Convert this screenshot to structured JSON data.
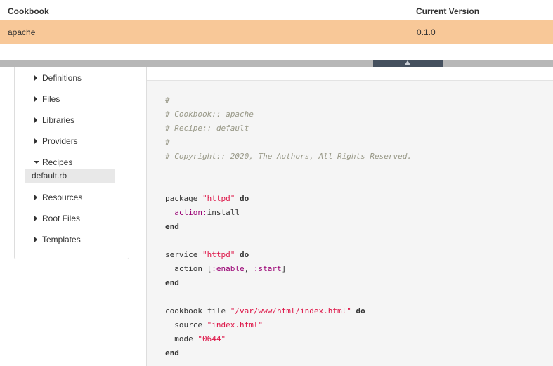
{
  "table": {
    "headers": {
      "cookbook": "Cookbook",
      "version": "Current Version"
    },
    "row": {
      "cookbook": "apache",
      "version": "0.1.0"
    }
  },
  "tree": {
    "items": [
      {
        "label": "Definitions",
        "expanded": false
      },
      {
        "label": "Files",
        "expanded": false
      },
      {
        "label": "Libraries",
        "expanded": false
      },
      {
        "label": "Providers",
        "expanded": false
      },
      {
        "label": "Recipes",
        "expanded": true
      },
      {
        "label": "Resources",
        "expanded": false
      },
      {
        "label": "Root Files",
        "expanded": false
      },
      {
        "label": "Templates",
        "expanded": false
      }
    ],
    "selected_child": "default.rb"
  },
  "code": {
    "comment_hash": "#",
    "comment_cookbook": "# Cookbook:: apache",
    "comment_recipe": "# Recipe:: default",
    "comment_copyright": "# Copyright:: 2020, The Authors, All Rights Reserved.",
    "kw_package": "package",
    "str_httpd": "\"httpd\"",
    "kw_do": "do",
    "kw_end": "end",
    "sym_action": "action:",
    "val_install": "install",
    "kw_service": "service",
    "kw_action": "action",
    "arr_open": "[",
    "sym_enable": ":enable",
    "comma": ", ",
    "sym_start": ":start",
    "arr_close": "]",
    "kw_cookbook_file": "cookbook_file",
    "str_path": "\"/var/www/html/index.html\"",
    "kw_source": "source",
    "str_index": "\"index.html\"",
    "kw_mode": "mode",
    "str_mode": "\"0644\""
  }
}
